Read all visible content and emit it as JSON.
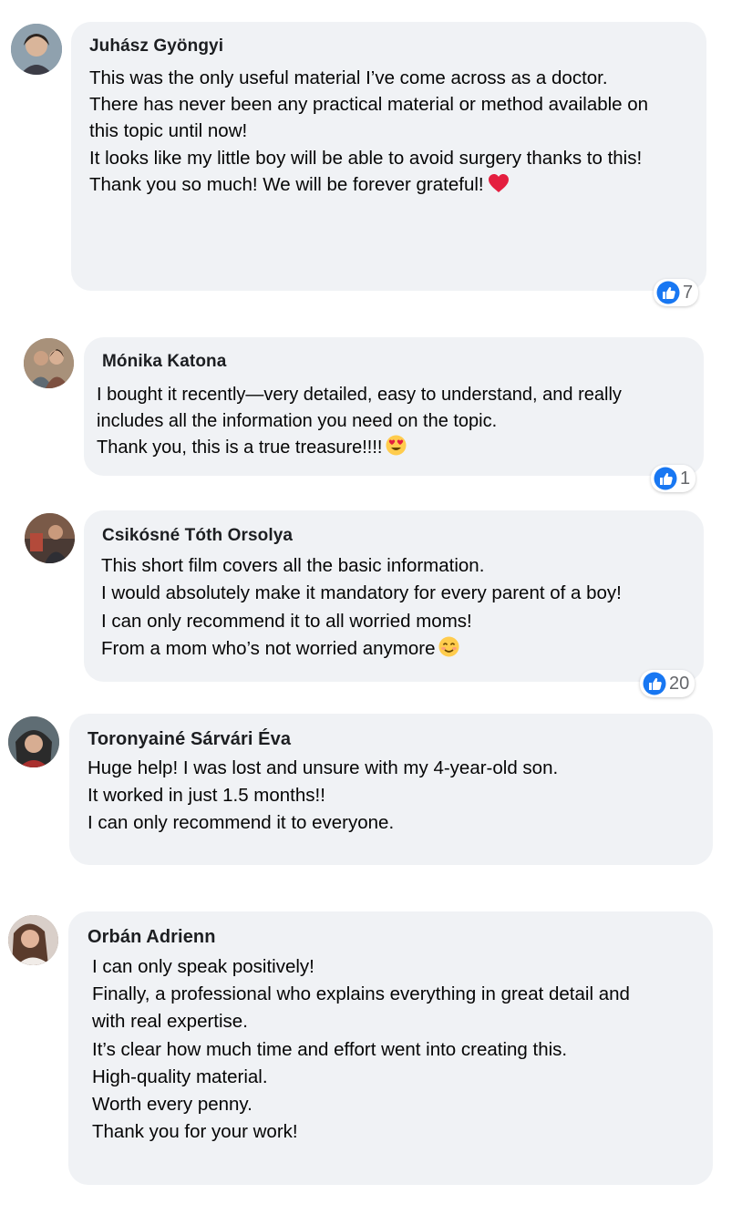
{
  "colors": {
    "bubble": "#f0f2f5",
    "like_blue": "#1877f2",
    "heart": "#e41e3f",
    "emoji_yellow": "#ffcc4d"
  },
  "comments": [
    {
      "author": "Juhász Gyöngyi",
      "lines": [
        "This was the only useful material I’ve come across as a doctor.",
        "There has never been any practical material or method available on",
        "this topic until now!",
        "It looks like my little boy will be able to avoid surgery thanks to this!",
        "Thank you so much! We will be forever grateful!"
      ],
      "trailing_emoji": "heart",
      "reaction_icon": "like-icon",
      "reaction_count": "7"
    },
    {
      "author": "Mónika Katona",
      "lines": [
        "I bought it recently—very detailed, easy to understand, and really",
        "includes all the information you need on the topic.",
        "Thank you, this is a true treasure!!!!"
      ],
      "trailing_emoji": "heart-eyes",
      "reaction_icon": "like-icon",
      "reaction_count": "1"
    },
    {
      "author": "Csikósné Tóth Orsolya",
      "lines": [
        "This short film covers all the basic information.",
        "I would absolutely make it mandatory for every parent of a boy!",
        "I can only recommend it to all worried moms!",
        "From a mom who’s not worried anymore"
      ],
      "trailing_emoji": "smiling-face",
      "reaction_icon": "like-icon",
      "reaction_count": "20"
    },
    {
      "author": "Toronyainé Sárvári Éva",
      "lines": [
        "Huge help! I was lost and unsure with my 4-year-old son.",
        "It worked in just 1.5 months!!",
        "I can only recommend it to everyone."
      ]
    },
    {
      "author": "Orbán Adrienn",
      "lines": [
        "I can only speak positively!",
        "Finally, a professional who explains everything in great detail and",
        "with real expertise.",
        "It’s clear how much time and effort went into creating this.",
        "High-quality material.",
        "Worth every penny.",
        "Thank you for your work!"
      ]
    }
  ]
}
